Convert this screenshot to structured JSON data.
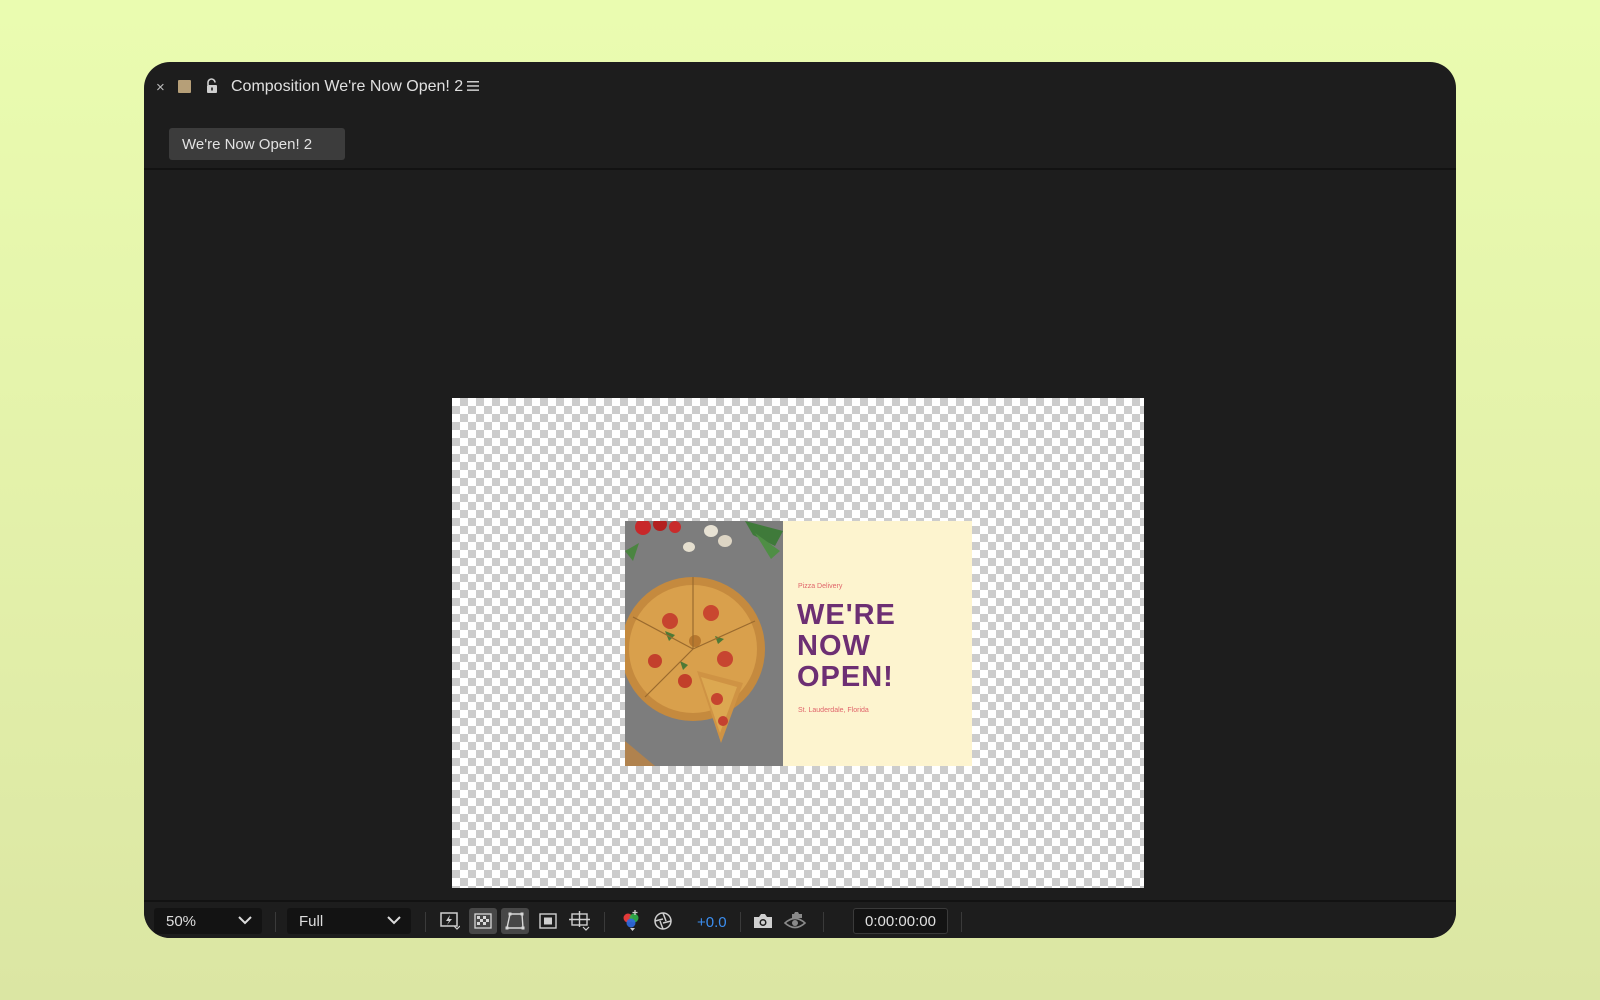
{
  "panel": {
    "close_glyph": "×",
    "title": "Composition We're Now Open! 2",
    "label_color": "#b69f78"
  },
  "subtab": {
    "label": "We're Now Open! 2"
  },
  "poster": {
    "kicker": "Pizza Delivery",
    "headline": [
      "WE'RE",
      "NOW",
      "OPEN!"
    ],
    "location": "St. Lauderdale, Florida",
    "headline_color": "#6d2f73",
    "accent_color": "#e0646a",
    "background_color": "#fdf4cf"
  },
  "toolbar": {
    "zoom": "50%",
    "resolution": "Full",
    "exposure": "+0.0",
    "timecode": "0:00:00:00",
    "buttons": [
      {
        "icon": "fast-previews-icon",
        "active": false
      },
      {
        "icon": "transparency-grid-icon",
        "active": true
      },
      {
        "icon": "mask-path-visibility-icon",
        "active": true
      },
      {
        "icon": "region-of-interest-icon",
        "active": false
      },
      {
        "icon": "grid-guides-icon",
        "active": false
      },
      {
        "icon": "color-channel-icon",
        "active": false
      },
      {
        "icon": "reset-exposure-icon",
        "active": false
      },
      {
        "icon": "snapshot-icon",
        "active": false
      },
      {
        "icon": "show-snapshot-icon",
        "active": false
      }
    ],
    "exposure_color": "#3b8ef0"
  }
}
